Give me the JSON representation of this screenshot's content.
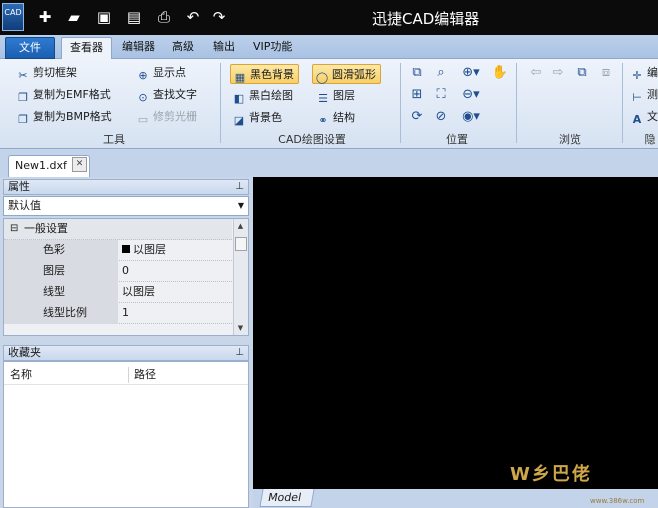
{
  "app": {
    "logo_text": "CAD",
    "title": "迅捷CAD编辑器"
  },
  "quick_access": [
    "new-icon",
    "open-icon",
    "save-icon",
    "export-pdf-icon",
    "print-icon",
    "undo-icon",
    "redo-icon"
  ],
  "tabs": [
    {
      "label": "文件",
      "active": false
    },
    {
      "label": "查看器",
      "active": true
    },
    {
      "label": "编辑器",
      "active": false
    },
    {
      "label": "高级",
      "active": false
    },
    {
      "label": "输出",
      "active": false
    },
    {
      "label": "VIP功能",
      "active": false
    }
  ],
  "ribbon": {
    "tools": {
      "label": "工具",
      "clip_frame": "剪切框架",
      "copy_emf": "复制为EMF格式",
      "copy_bmp": "复制为BMP格式",
      "show_points": "显示点",
      "find_text": "查找文字",
      "trim_raster": "修剪光栅"
    },
    "cad_settings": {
      "label": "CAD绘图设置",
      "black_bg": "黑色背景",
      "smooth_arc": "圆滑弧形",
      "bw_drawing": "黑白绘图",
      "layers": "图层",
      "bg_color": "背景色",
      "structure": "结构"
    },
    "position": {
      "label": "位置"
    },
    "browse": {
      "label": "浏览"
    },
    "hidden": {
      "label": "隐",
      "item1": "编",
      "item2": "测",
      "item3": "文"
    }
  },
  "documents": [
    {
      "name": "New1.dxf"
    }
  ],
  "properties_panel": {
    "title": "属性",
    "selector_value": "默认值",
    "category": "一般设置",
    "rows": [
      {
        "name": "色彩",
        "value": "以图层"
      },
      {
        "name": "图层",
        "value": "0"
      },
      {
        "name": "线型",
        "value": "以图层"
      },
      {
        "name": "线型比例",
        "value": "1"
      }
    ]
  },
  "favorites_panel": {
    "title": "收藏夹",
    "columns": [
      "名称",
      "路径"
    ]
  },
  "model_tab": "Model",
  "watermark": {
    "text": "W乡巴佬",
    "url": "www.386w.com"
  }
}
